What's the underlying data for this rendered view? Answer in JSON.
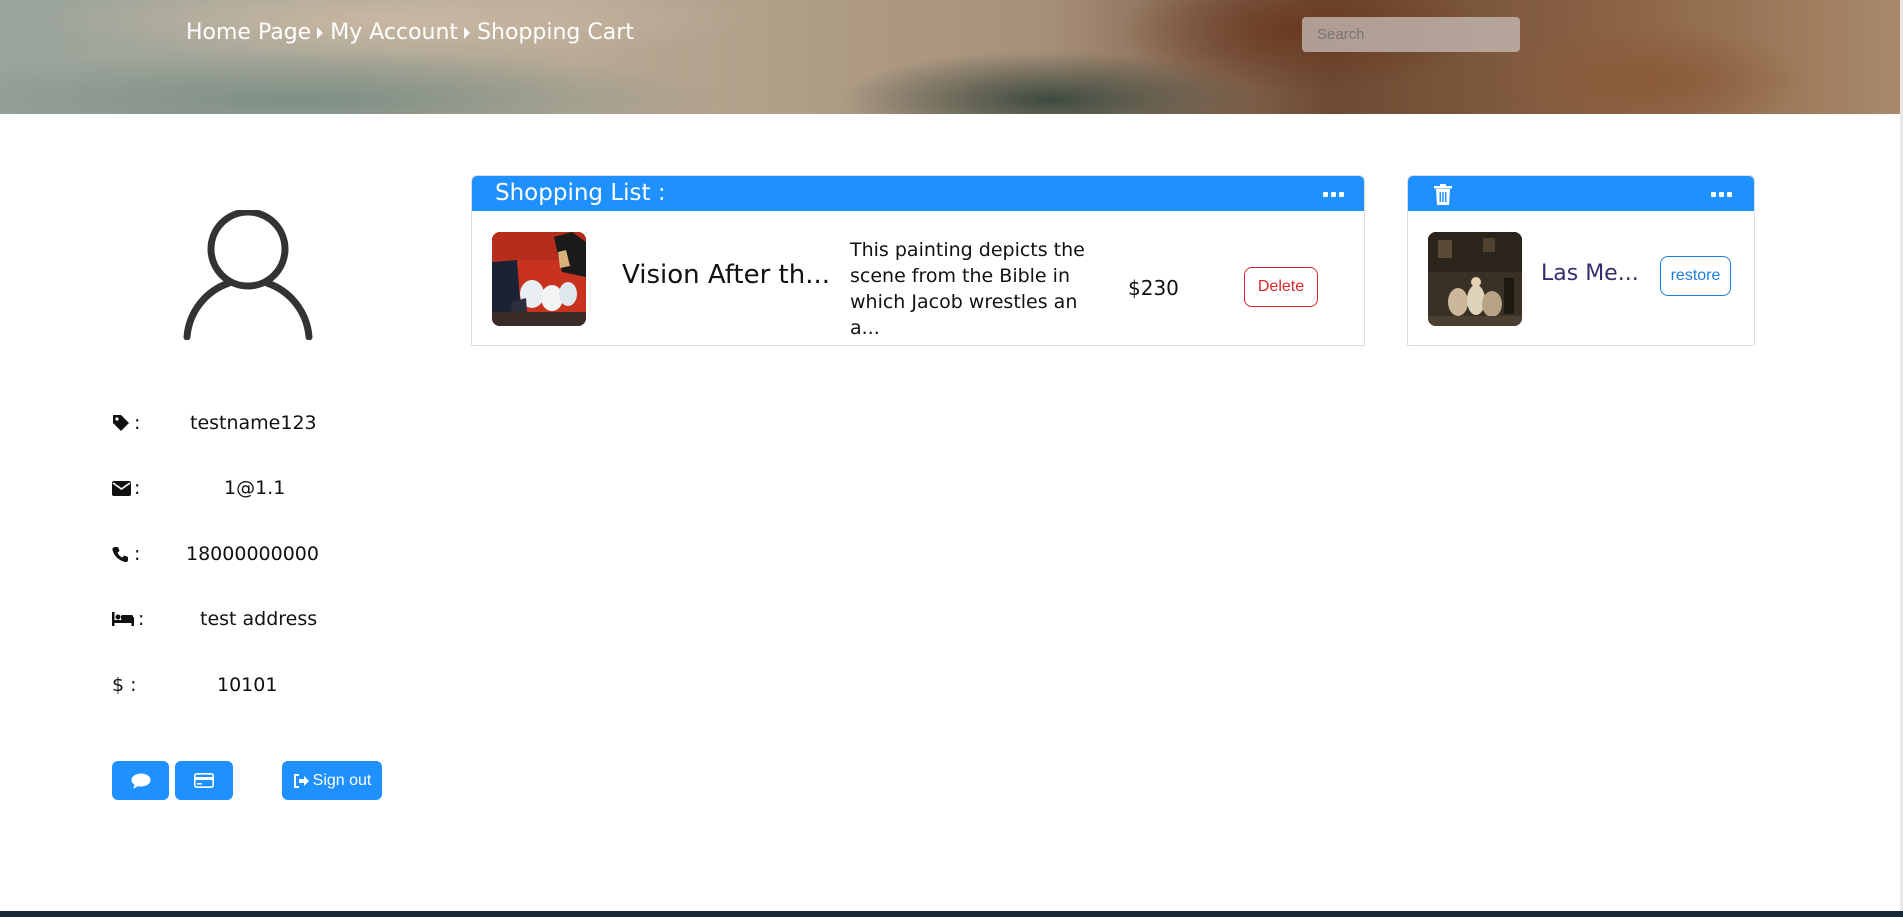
{
  "header": {
    "breadcrumbs": [
      "Home Page",
      "My Account",
      "Shopping Cart"
    ],
    "search_placeholder": "Search",
    "search_value": ""
  },
  "profile": {
    "rows": [
      {
        "icon": "tag-icon",
        "label": ":",
        "value": "testname123"
      },
      {
        "icon": "envelope-icon",
        "label": ":",
        "value": "1@1.1"
      },
      {
        "icon": "phone-icon",
        "label": ":",
        "value": "18000000000"
      },
      {
        "icon": "bed-icon",
        "label": ":",
        "value": "test address"
      },
      {
        "icon": "dollar-icon",
        "label": "$ :",
        "value": "10101"
      }
    ],
    "signout_label": "Sign out"
  },
  "shopping_list": {
    "title": "Shopping List :",
    "items": [
      {
        "title": "Vision After th...",
        "description": "This painting depicts the scene from the Bible in which Jacob wrestles an a...",
        "price": "$230",
        "delete_label": "Delete"
      }
    ]
  },
  "trash": {
    "items": [
      {
        "title": "Las Me...",
        "restore_label": "restore"
      }
    ]
  },
  "colors": {
    "accent": "#1e90ff",
    "delete": "#d9262b",
    "restore": "#1e7fd9",
    "trash_title": "#3a2a6e"
  }
}
